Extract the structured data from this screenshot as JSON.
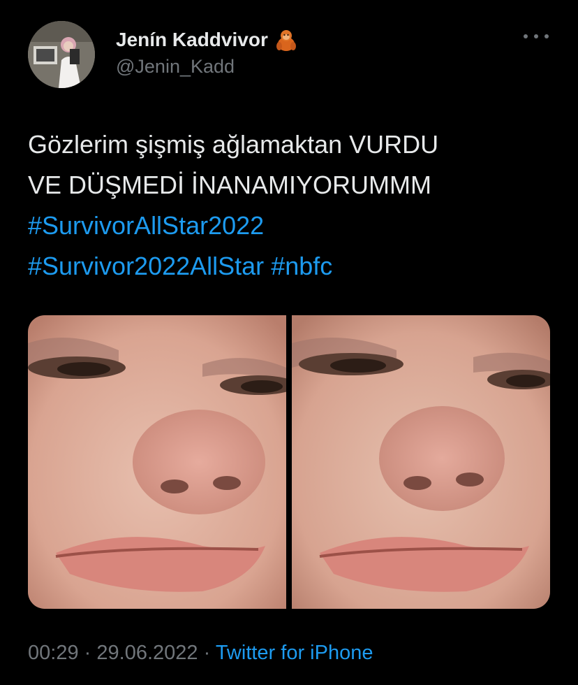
{
  "tweet": {
    "author": {
      "display_name": "Jenín Kaddvivor",
      "handle": "@Jenin_Kadd",
      "avatar_icon": "profile-photo",
      "name_emoji": "orangutan-emoji"
    },
    "more_icon": "more-horizontal-icon",
    "text_lines": [
      "Gözlerim şişmiş ağlamaktan VURDU",
      "VE DÜŞMEDİ İNANAMIYORUMMM"
    ],
    "hashtags": {
      "line1": "#SurvivorAllStar2022",
      "line2_a": "#Survivor2022AllStar",
      "line2_b": "#nbfc"
    },
    "media": [
      {
        "description_icon": "photo-face-close-up-left"
      },
      {
        "description_icon": "photo-face-close-up-right"
      }
    ],
    "time": "00:29",
    "separator": "·",
    "date": "29.06.2022",
    "source": "Twitter for iPhone"
  },
  "colors": {
    "background": "#000000",
    "text": "#e7e9ea",
    "secondary": "#71767b",
    "link": "#1d9bf0"
  }
}
